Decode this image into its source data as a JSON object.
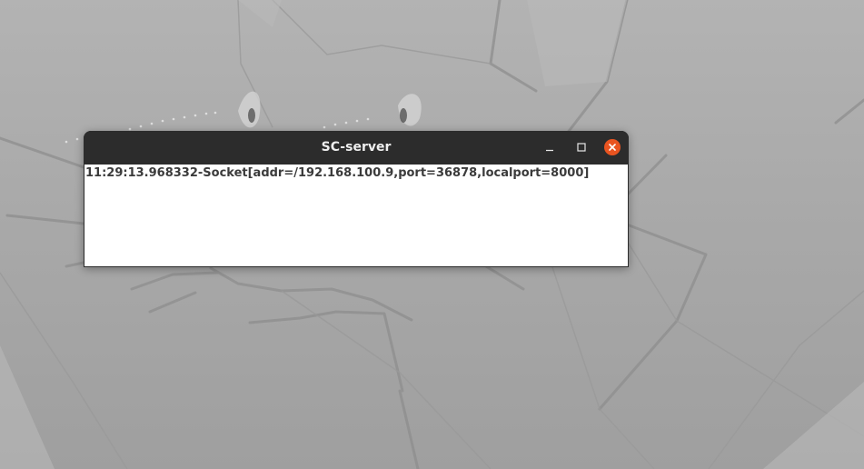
{
  "window": {
    "title": "SC-server",
    "controls": {
      "minimize_icon": "minimize-icon",
      "maximize_icon": "maximize-icon",
      "close_icon": "close-icon",
      "close_color": "#e95420"
    }
  },
  "log": {
    "lines": [
      "11:29:13.968332-Socket[addr=/192.168.100.9,port=36878,localport=8000]"
    ]
  }
}
